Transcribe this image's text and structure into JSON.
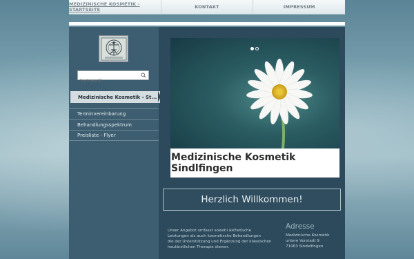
{
  "topnav": {
    "items": [
      {
        "label": "MEDIZINISCHE KOSMETIK - STARTSEITE"
      },
      {
        "label": "KONTAKT"
      },
      {
        "label": "IMPRESSUM"
      }
    ]
  },
  "sidebar": {
    "search_placeholder": "Suchbegriff",
    "active_item": "Medizinische Kosmetik - St...",
    "items": [
      {
        "label": "Terminvereinbarung"
      },
      {
        "label": "Behandlungsspektrum"
      },
      {
        "label": "Preisliste - Flyer"
      }
    ]
  },
  "hero": {
    "slides": 2,
    "active_slide": 1
  },
  "main": {
    "title": "Medizinische Kosmetik Sindlfingen",
    "welcome": "Herzlich Willkommen!",
    "intro_lines": [
      "Unser Angebot umfasst sowohl ästhetische",
      "Leistungen als auch kosmetische Behandlungen",
      "die der  Unterstützung und Ergänzung der klassischen",
      "hautärztlichen Therapie dienen."
    ]
  },
  "address": {
    "heading": "Adresse",
    "lines": [
      "Medizinische Kosmetik",
      "untere Vorstadt 9",
      "71063 Sindelfingen"
    ]
  },
  "colors": {
    "container": "#2c4a5c",
    "sidebar": "#3d5d70",
    "accent": "#d6dde0"
  }
}
